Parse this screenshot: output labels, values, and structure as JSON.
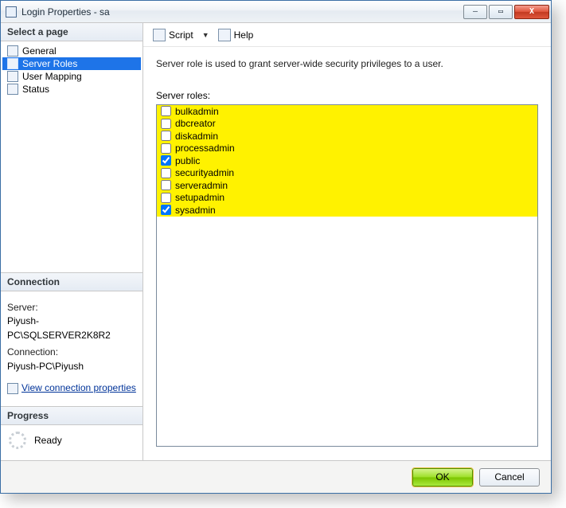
{
  "window": {
    "title": "Login Properties - sa",
    "min": "—",
    "max": "▭",
    "close": "X"
  },
  "sidebar": {
    "select_page": "Select a page",
    "items": [
      {
        "label": "General",
        "selected": false
      },
      {
        "label": "Server Roles",
        "selected": true
      },
      {
        "label": "User Mapping",
        "selected": false
      },
      {
        "label": "Status",
        "selected": false
      }
    ],
    "connection": {
      "header": "Connection",
      "server_label": "Server:",
      "server_value": "Piyush-PC\\SQLSERVER2K8R2",
      "conn_label": "Connection:",
      "conn_value": "Piyush-PC\\Piyush",
      "link": "View connection properties"
    },
    "progress": {
      "header": "Progress",
      "status": "Ready"
    }
  },
  "toolbar": {
    "script": "Script",
    "help": "Help"
  },
  "content": {
    "description": "Server role is used to grant server-wide security privileges to a user.",
    "list_label": "Server roles:",
    "roles": [
      {
        "name": "bulkadmin",
        "checked": false,
        "highlight": true
      },
      {
        "name": "dbcreator",
        "checked": false,
        "highlight": true
      },
      {
        "name": "diskadmin",
        "checked": false,
        "highlight": true
      },
      {
        "name": "processadmin",
        "checked": false,
        "highlight": true
      },
      {
        "name": "public",
        "checked": true,
        "highlight": true
      },
      {
        "name": "securityadmin",
        "checked": false,
        "highlight": true
      },
      {
        "name": "serveradmin",
        "checked": false,
        "highlight": true
      },
      {
        "name": "setupadmin",
        "checked": false,
        "highlight": true
      },
      {
        "name": "sysadmin",
        "checked": true,
        "highlight": true
      }
    ]
  },
  "footer": {
    "ok": "OK",
    "cancel": "Cancel"
  }
}
